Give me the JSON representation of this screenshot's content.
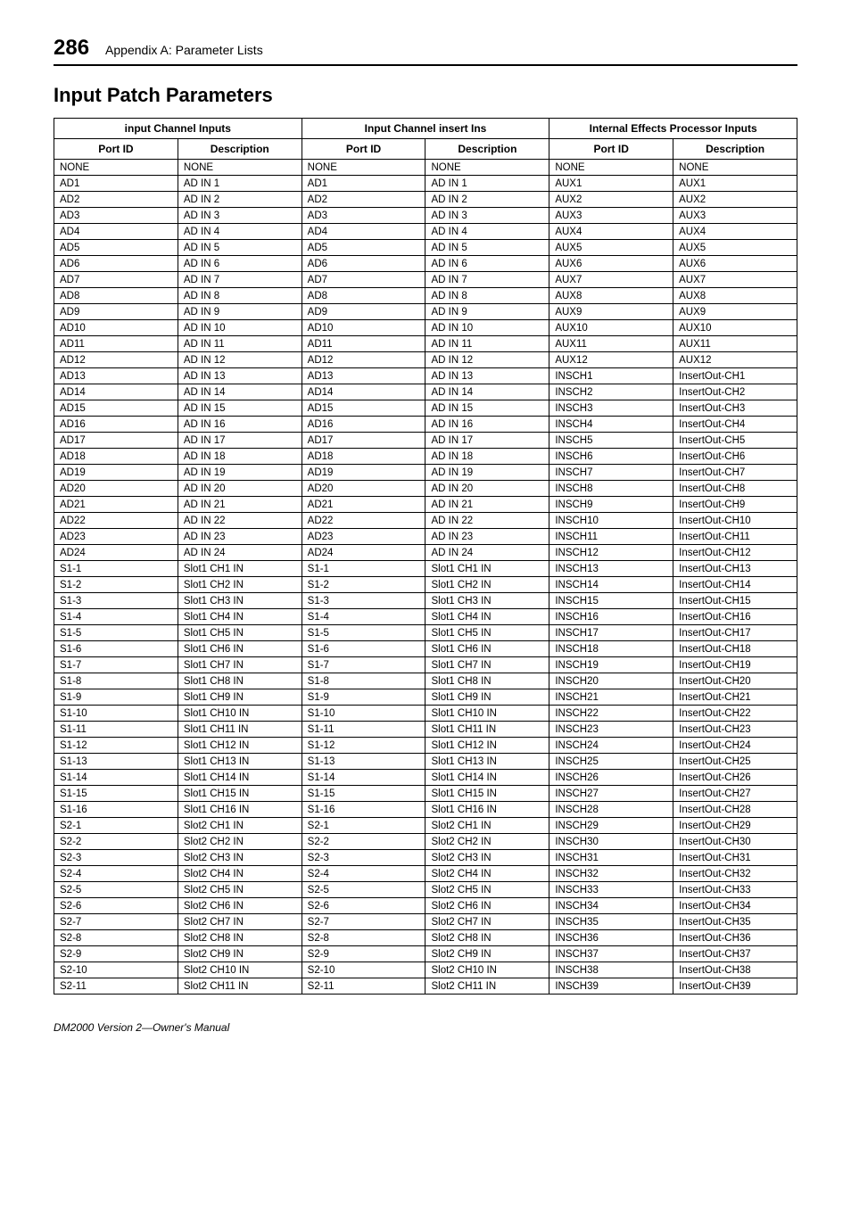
{
  "page_number": "286",
  "appendix_title": "Appendix A: Parameter Lists",
  "section_title": "Input Patch Parameters",
  "footer": "DM2000 Version 2—Owner's Manual",
  "table": {
    "group_headers": [
      "input Channel Inputs",
      "Input Channel insert Ins",
      "Internal Effects Processor Inputs"
    ],
    "col_headers": [
      "Port ID",
      "Description",
      "Port ID",
      "Description",
      "Port ID",
      "Description"
    ],
    "rows": [
      [
        "NONE",
        "NONE",
        "NONE",
        "NONE",
        "NONE",
        "NONE"
      ],
      [
        "AD1",
        "AD IN 1",
        "AD1",
        "AD IN 1",
        "AUX1",
        "AUX1"
      ],
      [
        "AD2",
        "AD IN 2",
        "AD2",
        "AD IN 2",
        "AUX2",
        "AUX2"
      ],
      [
        "AD3",
        "AD IN 3",
        "AD3",
        "AD IN 3",
        "AUX3",
        "AUX3"
      ],
      [
        "AD4",
        "AD IN 4",
        "AD4",
        "AD IN 4",
        "AUX4",
        "AUX4"
      ],
      [
        "AD5",
        "AD IN 5",
        "AD5",
        "AD IN 5",
        "AUX5",
        "AUX5"
      ],
      [
        "AD6",
        "AD IN 6",
        "AD6",
        "AD IN 6",
        "AUX6",
        "AUX6"
      ],
      [
        "AD7",
        "AD IN 7",
        "AD7",
        "AD IN 7",
        "AUX7",
        "AUX7"
      ],
      [
        "AD8",
        "AD IN 8",
        "AD8",
        "AD IN 8",
        "AUX8",
        "AUX8"
      ],
      [
        "AD9",
        "AD IN 9",
        "AD9",
        "AD IN 9",
        "AUX9",
        "AUX9"
      ],
      [
        "AD10",
        "AD IN 10",
        "AD10",
        "AD IN 10",
        "AUX10",
        "AUX10"
      ],
      [
        "AD11",
        "AD IN 11",
        "AD11",
        "AD IN 11",
        "AUX11",
        "AUX11"
      ],
      [
        "AD12",
        "AD IN 12",
        "AD12",
        "AD IN 12",
        "AUX12",
        "AUX12"
      ],
      [
        "AD13",
        "AD IN 13",
        "AD13",
        "AD IN 13",
        "INSCH1",
        "InsertOut-CH1"
      ],
      [
        "AD14",
        "AD IN 14",
        "AD14",
        "AD IN 14",
        "INSCH2",
        "InsertOut-CH2"
      ],
      [
        "AD15",
        "AD IN 15",
        "AD15",
        "AD IN 15",
        "INSCH3",
        "InsertOut-CH3"
      ],
      [
        "AD16",
        "AD IN 16",
        "AD16",
        "AD IN 16",
        "INSCH4",
        "InsertOut-CH4"
      ],
      [
        "AD17",
        "AD IN 17",
        "AD17",
        "AD IN 17",
        "INSCH5",
        "InsertOut-CH5"
      ],
      [
        "AD18",
        "AD IN 18",
        "AD18",
        "AD IN 18",
        "INSCH6",
        "InsertOut-CH6"
      ],
      [
        "AD19",
        "AD IN 19",
        "AD19",
        "AD IN 19",
        "INSCH7",
        "InsertOut-CH7"
      ],
      [
        "AD20",
        "AD IN 20",
        "AD20",
        "AD IN 20",
        "INSCH8",
        "InsertOut-CH8"
      ],
      [
        "AD21",
        "AD IN 21",
        "AD21",
        "AD IN 21",
        "INSCH9",
        "InsertOut-CH9"
      ],
      [
        "AD22",
        "AD IN 22",
        "AD22",
        "AD IN 22",
        "INSCH10",
        "InsertOut-CH10"
      ],
      [
        "AD23",
        "AD IN 23",
        "AD23",
        "AD IN 23",
        "INSCH11",
        "InsertOut-CH11"
      ],
      [
        "AD24",
        "AD IN 24",
        "AD24",
        "AD IN 24",
        "INSCH12",
        "InsertOut-CH12"
      ],
      [
        "S1-1",
        "Slot1 CH1 IN",
        "S1-1",
        "Slot1 CH1 IN",
        "INSCH13",
        "InsertOut-CH13"
      ],
      [
        "S1-2",
        "Slot1 CH2 IN",
        "S1-2",
        "Slot1 CH2 IN",
        "INSCH14",
        "InsertOut-CH14"
      ],
      [
        "S1-3",
        "Slot1 CH3 IN",
        "S1-3",
        "Slot1 CH3 IN",
        "INSCH15",
        "InsertOut-CH15"
      ],
      [
        "S1-4",
        "Slot1 CH4 IN",
        "S1-4",
        "Slot1 CH4 IN",
        "INSCH16",
        "InsertOut-CH16"
      ],
      [
        "S1-5",
        "Slot1 CH5 IN",
        "S1-5",
        "Slot1 CH5 IN",
        "INSCH17",
        "InsertOut-CH17"
      ],
      [
        "S1-6",
        "Slot1 CH6 IN",
        "S1-6",
        "Slot1 CH6 IN",
        "INSCH18",
        "InsertOut-CH18"
      ],
      [
        "S1-7",
        "Slot1 CH7 IN",
        "S1-7",
        "Slot1 CH7 IN",
        "INSCH19",
        "InsertOut-CH19"
      ],
      [
        "S1-8",
        "Slot1 CH8 IN",
        "S1-8",
        "Slot1 CH8 IN",
        "INSCH20",
        "InsertOut-CH20"
      ],
      [
        "S1-9",
        "Slot1 CH9 IN",
        "S1-9",
        "Slot1 CH9 IN",
        "INSCH21",
        "InsertOut-CH21"
      ],
      [
        "S1-10",
        "Slot1 CH10 IN",
        "S1-10",
        "Slot1 CH10 IN",
        "INSCH22",
        "InsertOut-CH22"
      ],
      [
        "S1-11",
        "Slot1 CH11 IN",
        "S1-11",
        "Slot1 CH11 IN",
        "INSCH23",
        "InsertOut-CH23"
      ],
      [
        "S1-12",
        "Slot1 CH12 IN",
        "S1-12",
        "Slot1 CH12 IN",
        "INSCH24",
        "InsertOut-CH24"
      ],
      [
        "S1-13",
        "Slot1 CH13 IN",
        "S1-13",
        "Slot1 CH13 IN",
        "INSCH25",
        "InsertOut-CH25"
      ],
      [
        "S1-14",
        "Slot1 CH14 IN",
        "S1-14",
        "Slot1 CH14 IN",
        "INSCH26",
        "InsertOut-CH26"
      ],
      [
        "S1-15",
        "Slot1 CH15 IN",
        "S1-15",
        "Slot1 CH15 IN",
        "INSCH27",
        "InsertOut-CH27"
      ],
      [
        "S1-16",
        "Slot1 CH16 IN",
        "S1-16",
        "Slot1 CH16 IN",
        "INSCH28",
        "InsertOut-CH28"
      ],
      [
        "S2-1",
        "Slot2 CH1 IN",
        "S2-1",
        "Slot2 CH1 IN",
        "INSCH29",
        "InsertOut-CH29"
      ],
      [
        "S2-2",
        "Slot2 CH2 IN",
        "S2-2",
        "Slot2 CH2 IN",
        "INSCH30",
        "InsertOut-CH30"
      ],
      [
        "S2-3",
        "Slot2 CH3 IN",
        "S2-3",
        "Slot2 CH3 IN",
        "INSCH31",
        "InsertOut-CH31"
      ],
      [
        "S2-4",
        "Slot2 CH4 IN",
        "S2-4",
        "Slot2 CH4 IN",
        "INSCH32",
        "InsertOut-CH32"
      ],
      [
        "S2-5",
        "Slot2 CH5 IN",
        "S2-5",
        "Slot2 CH5 IN",
        "INSCH33",
        "InsertOut-CH33"
      ],
      [
        "S2-6",
        "Slot2 CH6 IN",
        "S2-6",
        "Slot2 CH6 IN",
        "INSCH34",
        "InsertOut-CH34"
      ],
      [
        "S2-7",
        "Slot2 CH7 IN",
        "S2-7",
        "Slot2 CH7 IN",
        "INSCH35",
        "InsertOut-CH35"
      ],
      [
        "S2-8",
        "Slot2 CH8 IN",
        "S2-8",
        "Slot2 CH8 IN",
        "INSCH36",
        "InsertOut-CH36"
      ],
      [
        "S2-9",
        "Slot2 CH9 IN",
        "S2-9",
        "Slot2 CH9 IN",
        "INSCH37",
        "InsertOut-CH37"
      ],
      [
        "S2-10",
        "Slot2 CH10 IN",
        "S2-10",
        "Slot2 CH10 IN",
        "INSCH38",
        "InsertOut-CH38"
      ],
      [
        "S2-11",
        "Slot2 CH11 IN",
        "S2-11",
        "Slot2 CH11 IN",
        "INSCH39",
        "InsertOut-CH39"
      ]
    ]
  }
}
